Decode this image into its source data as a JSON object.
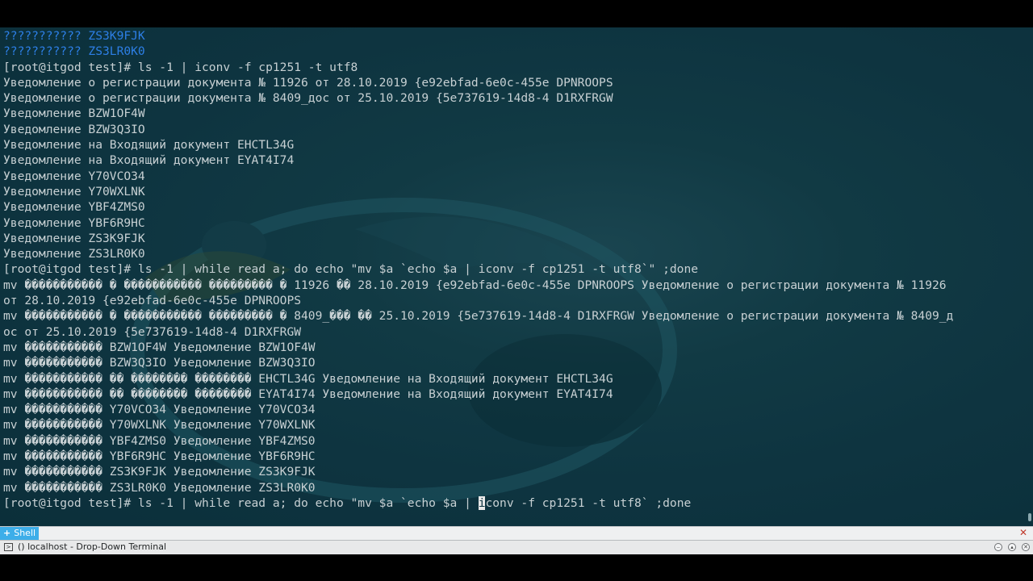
{
  "terminal": {
    "lines": [
      {
        "text": "??????????? ZS3K9FJK",
        "color": "blue"
      },
      {
        "text": "??????????? ZS3LR0K0",
        "color": "blue"
      },
      {
        "text": "[root@itgod test]# ls -1 | iconv -f cp1251 -t utf8"
      },
      {
        "text": "Уведомление о регистрации документа № 11926 от 28.10.2019 {e92ebfad-6e0c-455e DPNROOPS"
      },
      {
        "text": "Уведомление о регистрации документа № 8409_дос от 25.10.2019 {5e737619-14d8-4 D1RXFRGW"
      },
      {
        "text": "Уведомление BZW1OF4W"
      },
      {
        "text": "Уведомление BZW3Q3IO"
      },
      {
        "text": "Уведомление на Входящий документ EHCTL34G"
      },
      {
        "text": "Уведомление на Входящий документ EYAT4I74"
      },
      {
        "text": "Уведомление Y70VCO34"
      },
      {
        "text": "Уведомление Y70WXLNK"
      },
      {
        "text": "Уведомление YBF4ZMS0"
      },
      {
        "text": "Уведомление YBF6R9HC"
      },
      {
        "text": "Уведомление ZS3K9FJK"
      },
      {
        "text": "Уведомление ZS3LR0K0"
      },
      {
        "text": "[root@itgod test]# ls -1 | while read a; do echo \"mv $a `echo $a | iconv -f cp1251 -t utf8`\" ;done"
      },
      {
        "text": "mv ����������� � ����������� ��������� � 11926 �� 28.10.2019 {e92ebfad-6e0c-455e DPNROOPS Уведомление о регистрации документа № 11926"
      },
      {
        "text": "от 28.10.2019 {e92ebfad-6e0c-455e DPNROOPS"
      },
      {
        "text": "mv ����������� � ����������� ��������� � 8409_��� �� 25.10.2019 {5e737619-14d8-4 D1RXFRGW Уведомление о регистрации документа № 8409_д"
      },
      {
        "text": "ос от 25.10.2019 {5e737619-14d8-4 D1RXFRGW"
      },
      {
        "text": "mv ����������� BZW1OF4W Уведомление BZW1OF4W"
      },
      {
        "text": "mv ����������� BZW3Q3IO Уведомление BZW3Q3IO"
      },
      {
        "text": "mv ����������� �� �������� �������� EHCTL34G Уведомление на Входящий документ EHCTL34G"
      },
      {
        "text": "mv ����������� �� �������� �������� EYAT4I74 Уведомление на Входящий документ EYAT4I74"
      },
      {
        "text": "mv ����������� Y70VCO34 Уведомление Y70VCO34"
      },
      {
        "text": "mv ����������� Y70WXLNK Уведомление Y70WXLNK"
      },
      {
        "text": "mv ����������� YBF4ZMS0 Уведомление YBF4ZMS0"
      },
      {
        "text": "mv ����������� YBF6R9HC Уведомление YBF6R9HC"
      },
      {
        "text": "mv ����������� ZS3K9FJK Уведомление ZS3K9FJK"
      },
      {
        "text": "mv ����������� ZS3LR0K0 Уведомление ZS3LR0K0"
      }
    ],
    "prompt_line": {
      "before_cursor": "[root@itgod test]# ls -1 | while read a; do echo \"mv $a `echo $a | ",
      "cursor_char": "i",
      "after_cursor": "conv -f cp1251 -t utf8` ;done"
    }
  },
  "tab_bar": {
    "tab_icon": "plus-icon",
    "tab_label": "Shell",
    "close_icon": "close-icon"
  },
  "taskbar": {
    "window_icon": "terminal-icon",
    "window_title": "() localhost - Drop-Down Terminal",
    "buttons": [
      "minimize-icon",
      "maximize-icon",
      "close-icon"
    ]
  },
  "colors": {
    "terminal_background": "#0e3440",
    "terminal_text": "#c7d0d3",
    "highlight_blue": "#2d7fe6",
    "tab_active": "#3daee9"
  }
}
